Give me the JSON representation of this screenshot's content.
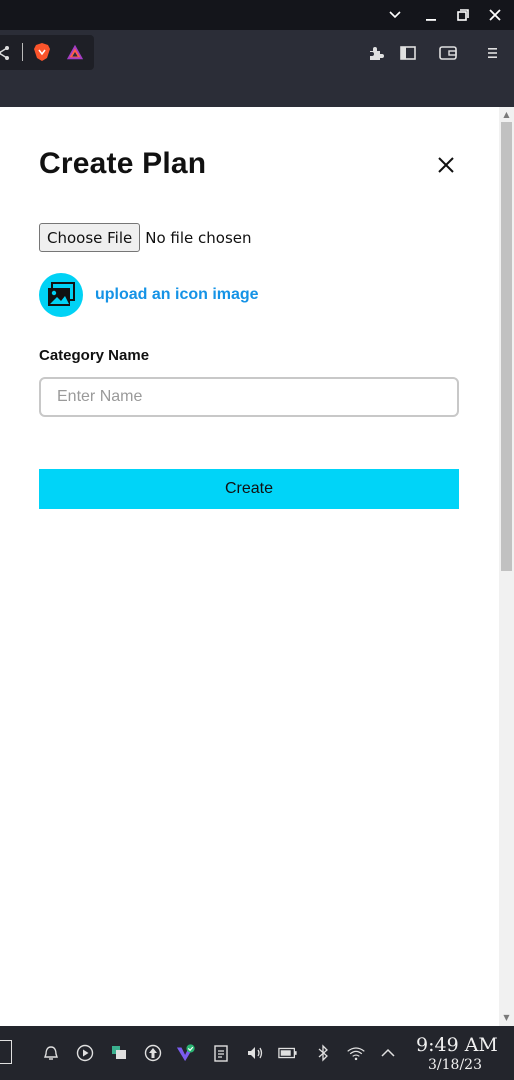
{
  "window": {
    "minimize_icon": "minimize-icon",
    "restore_icon": "restore-icon",
    "close_icon": "close-icon"
  },
  "toolbar": {
    "icons": [
      "share-icon",
      "brave-shield-icon",
      "brave-rewards-icon",
      "extensions-icon",
      "sidebar-icon",
      "wallet-icon",
      "menu-icon"
    ]
  },
  "dialog": {
    "title": "Create Plan",
    "choose_file_label": "Choose File",
    "file_status": "No file chosen",
    "upload_label": "upload an icon image",
    "category_label": "Category Name",
    "name_placeholder": "Enter Name",
    "name_value": "",
    "create_label": "Create"
  },
  "colors": {
    "accent": "#00d4f8",
    "link": "#1593e6"
  },
  "taskbar": {
    "time": "9:49 AM",
    "date": "3/18/23"
  }
}
